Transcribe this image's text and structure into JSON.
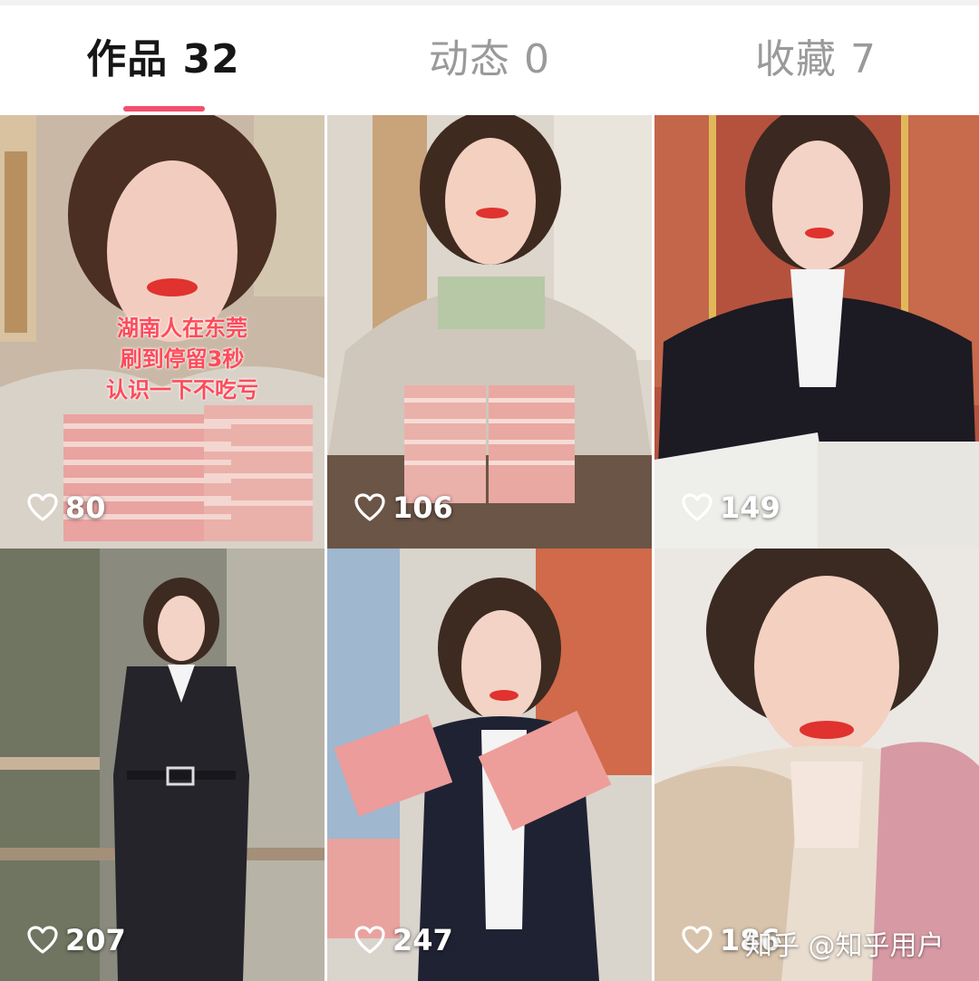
{
  "tabs": [
    {
      "label": "作品 32",
      "active": true
    },
    {
      "label": "动态 0",
      "active": false
    },
    {
      "label": "收藏 7",
      "active": false
    }
  ],
  "accent_color": "#f0506e",
  "videos": [
    {
      "likes": "80",
      "caption": "湖南人在东莞 刷到停留3秒 认识一下不吃亏"
    },
    {
      "likes": "106"
    },
    {
      "likes": "149"
    },
    {
      "likes": "207"
    },
    {
      "likes": "247"
    },
    {
      "likes": "186"
    }
  ],
  "watermark": "知乎 @知乎用户",
  "icons": {
    "like": "heart-outline-icon"
  }
}
